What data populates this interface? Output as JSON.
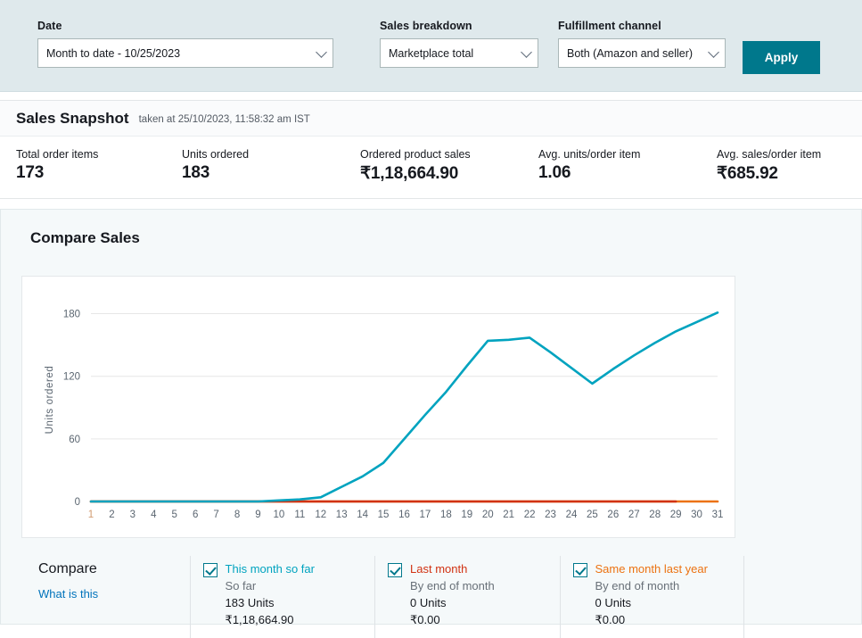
{
  "filters": {
    "date": {
      "label": "Date",
      "value": "Month to date - 10/25/2023"
    },
    "breakdown": {
      "label": "Sales breakdown",
      "value": "Marketplace total"
    },
    "channel": {
      "label": "Fulfillment channel",
      "value": "Both (Amazon and seller)"
    },
    "apply_label": "Apply"
  },
  "snapshot": {
    "title": "Sales Snapshot",
    "subtitle": "taken at 25/10/2023, 11:58:32 am IST",
    "metrics": [
      {
        "label": "Total order items",
        "value": "173"
      },
      {
        "label": "Units ordered",
        "value": "183"
      },
      {
        "label": "Ordered product sales",
        "value": "₹1,18,664.90"
      },
      {
        "label": "Avg. units/order item",
        "value": "1.06"
      },
      {
        "label": "Avg. sales/order item",
        "value": "₹685.92"
      }
    ]
  },
  "compare": {
    "title": "Compare Sales",
    "heading": "Compare",
    "what_is_this": "What is this",
    "items": [
      {
        "name": "This month so far",
        "sub": "So far",
        "units": "183 Units",
        "amount": "₹1,18,664.90",
        "color": "#00a3bf",
        "checked": true
      },
      {
        "name": "Last month",
        "sub": "By end of month",
        "units": "0 Units",
        "amount": "₹0.00",
        "color": "#d13212",
        "checked": true
      },
      {
        "name": "Same month last year",
        "sub": "By end of month",
        "units": "0 Units",
        "amount": "₹0.00",
        "color": "#ec7211",
        "checked": true
      }
    ]
  },
  "chart_data": {
    "type": "line",
    "title": "Compare Sales",
    "xlabel": "",
    "ylabel": "Units ordered",
    "x": [
      1,
      2,
      3,
      4,
      5,
      6,
      7,
      8,
      9,
      10,
      11,
      12,
      13,
      14,
      15,
      16,
      17,
      18,
      19,
      20,
      21,
      22,
      23,
      24,
      25,
      26,
      27,
      28,
      29,
      30,
      31
    ],
    "xlim": [
      1,
      31
    ],
    "ylim": [
      0,
      195
    ],
    "yticks": [
      0,
      60,
      120,
      180
    ],
    "grid": true,
    "legend_position": "bottom",
    "series": [
      {
        "name": "This month so far",
        "color": "#00a3bf",
        "values": [
          0,
          0,
          0,
          0,
          0,
          0,
          0,
          0,
          0,
          1,
          2,
          4,
          14,
          24,
          37,
          60,
          83,
          105,
          130,
          154,
          155,
          157,
          143,
          128,
          113,
          127,
          140,
          152,
          163,
          172,
          181
        ]
      },
      {
        "name": "Last month",
        "color": "#d13212",
        "values": [
          0,
          0,
          0,
          0,
          0,
          0,
          0,
          0,
          0,
          0,
          0,
          0,
          0,
          0,
          0,
          0,
          0,
          0,
          0,
          0,
          0,
          0,
          0,
          0,
          0,
          0,
          0,
          0,
          0,
          null,
          null
        ]
      },
      {
        "name": "Same month last year",
        "color": "#ec7211",
        "values": [
          0,
          0,
          0,
          0,
          0,
          0,
          0,
          0,
          0,
          0,
          0,
          0,
          0,
          0,
          0,
          0,
          0,
          0,
          0,
          0,
          0,
          0,
          0,
          0,
          0,
          0,
          0,
          0,
          0,
          0,
          0
        ]
      }
    ]
  }
}
